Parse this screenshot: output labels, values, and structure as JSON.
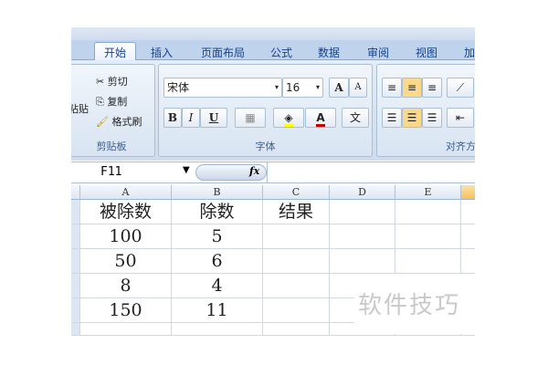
{
  "tabs": [
    "开始",
    "插入",
    "页面布局",
    "公式",
    "数据",
    "审阅",
    "视图",
    "加"
  ],
  "clipboard": {
    "paste": "粘贴",
    "cut": "剪切",
    "copy": "复制",
    "format_painter": "格式刷",
    "label": "剪贴板"
  },
  "font": {
    "name": "宋体",
    "size": "16",
    "bold": "B",
    "italic": "I",
    "underline": "U",
    "grow": "A",
    "shrink": "A",
    "font_color": "A",
    "phonetic": "文",
    "label": "字体"
  },
  "alignment": {
    "label": "对齐方"
  },
  "formula_bar": {
    "name_box": "F11",
    "fx": "fx",
    "value": ""
  },
  "columns": [
    "A",
    "B",
    "C",
    "D",
    "E"
  ],
  "rows": [
    [
      "被除数",
      "除数",
      "结果"
    ],
    [
      "100",
      "5",
      ""
    ],
    [
      "50",
      "6",
      ""
    ],
    [
      "8",
      "4",
      ""
    ],
    [
      "150",
      "11",
      ""
    ]
  ],
  "watermark": "软件技巧"
}
